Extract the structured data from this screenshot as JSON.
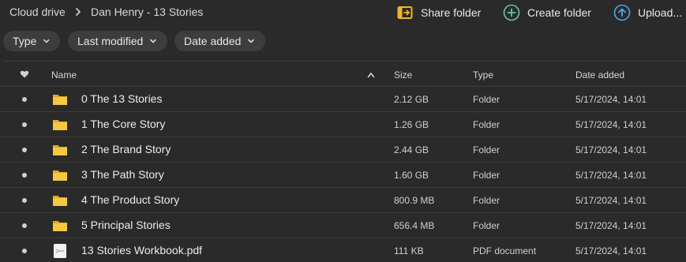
{
  "breadcrumb": {
    "root": "Cloud drive",
    "current": "Dan Henry - 13 Stories"
  },
  "actions": {
    "share_folder": "Share folder",
    "create_folder": "Create folder",
    "upload": "Upload..."
  },
  "filters": {
    "type": "Type",
    "last_modified": "Last modified",
    "date_added": "Date added"
  },
  "table": {
    "headers": {
      "name": "Name",
      "size": "Size",
      "type": "Type",
      "date_added": "Date added"
    },
    "rows": [
      {
        "name": "0 The 13 Stories",
        "size": "2.12 GB",
        "type": "Folder",
        "date_added": "5/17/2024, 14:01",
        "icon": "folder-icon"
      },
      {
        "name": "1 The Core Story",
        "size": "1.26 GB",
        "type": "Folder",
        "date_added": "5/17/2024, 14:01",
        "icon": "folder-icon"
      },
      {
        "name": "2 The Brand Story",
        "size": "2.44 GB",
        "type": "Folder",
        "date_added": "5/17/2024, 14:01",
        "icon": "folder-icon"
      },
      {
        "name": "3 The Path Story",
        "size": "1.60 GB",
        "type": "Folder",
        "date_added": "5/17/2024, 14:01",
        "icon": "folder-icon"
      },
      {
        "name": "4 The Product Story",
        "size": "800.9 MB",
        "type": "Folder",
        "date_added": "5/17/2024, 14:01",
        "icon": "folder-icon"
      },
      {
        "name": "5 Principal Stories",
        "size": "656.4 MB",
        "type": "Folder",
        "date_added": "5/17/2024, 14:01",
        "icon": "folder-icon"
      },
      {
        "name": "13 Stories Workbook.pdf",
        "size": "111 KB",
        "type": "PDF document",
        "date_added": "5/17/2024, 14:01",
        "icon": "pdf-file-icon"
      }
    ]
  },
  "colors": {
    "background": "#2a2a2a",
    "chip": "#3d3d3d",
    "folder": "#f5c842",
    "share_icon": "#f0b429",
    "create_icon": "#5fc9a8",
    "upload_icon": "#4aa8e8"
  }
}
